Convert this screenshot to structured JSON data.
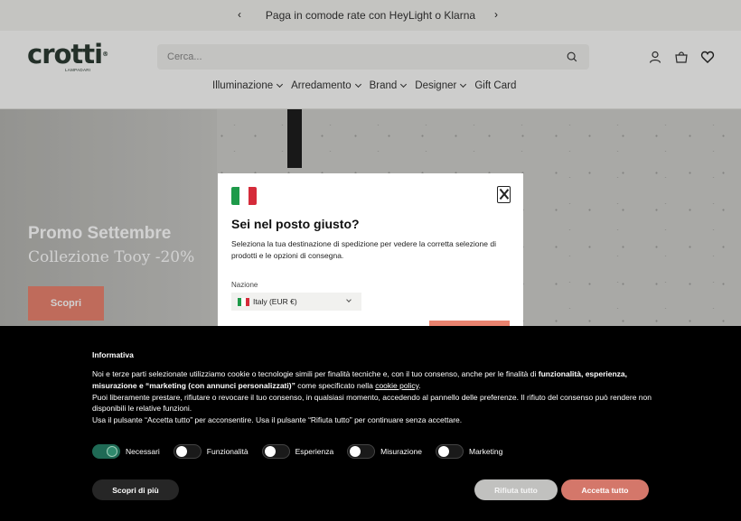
{
  "announcement": {
    "text": "Paga in comode rate con HeyLight o Klarna",
    "prev_icon": "chevron-left-icon",
    "next_icon": "chevron-right-icon"
  },
  "header": {
    "logo_text": "crotti",
    "logo_sub": "LAMPADARI",
    "logo_reg": "®",
    "search_placeholder": "Cerca...",
    "icons": [
      "search-icon",
      "account-icon",
      "cart-icon",
      "wishlist-icon"
    ]
  },
  "nav": {
    "items": [
      {
        "label": "Illuminazione",
        "dropdown": true
      },
      {
        "label": "Arredamento",
        "dropdown": true
      },
      {
        "label": "Brand",
        "dropdown": true
      },
      {
        "label": "Designer",
        "dropdown": true
      },
      {
        "label": "Gift Card",
        "dropdown": false
      }
    ]
  },
  "hero": {
    "title": "Promo Settembre",
    "subtitle": "Collezione Tooy -20%",
    "button": "Scopri",
    "accent": "#e9836f"
  },
  "country_modal": {
    "title": "Sei nel posto giusto?",
    "text": "Seleziona la tua destinazione di spedizione per vedere la corretta selezione di prodotti e le opzioni di consegna.",
    "field_label": "Nazione",
    "selected": "Italy (EUR €)",
    "flag_colors": [
      "#1e9a4a",
      "#ffffff",
      "#d52b3a"
    ]
  },
  "cookie": {
    "title": "Informativa",
    "p1_a": "Noi e terze parti selezionate utilizziamo cookie o tecnologie simili per finalità tecniche e, con il tuo consenso, anche per le finalità di ",
    "p1_b": "funzionalità, esperienza, misurazione e “marketing (con annunci personalizzati)”",
    "p1_c": " come specificato nella ",
    "p1_link": "cookie policy",
    "p1_d": ".",
    "p2": "Puoi liberamente prestare, rifiutare o revocare il tuo consenso, in qualsiasi momento, accedendo al pannello delle preferenze. Il rifiuto del consenso può rendere non disponibili le relative funzioni.",
    "p3": "Usa il pulsante “Accetta tutto” per acconsentire. Usa il pulsante “Rifiuta tutto” per continuare senza accettare.",
    "toggles": [
      {
        "label": "Necessari",
        "on": true
      },
      {
        "label": "Funzionalità",
        "on": false
      },
      {
        "label": "Esperienza",
        "on": false
      },
      {
        "label": "Misurazione",
        "on": false
      },
      {
        "label": "Marketing",
        "on": false
      }
    ],
    "more_button": "Scopri di più",
    "reject_button": "Rifiuta tutto",
    "accept_button": "Accetta tutto"
  }
}
